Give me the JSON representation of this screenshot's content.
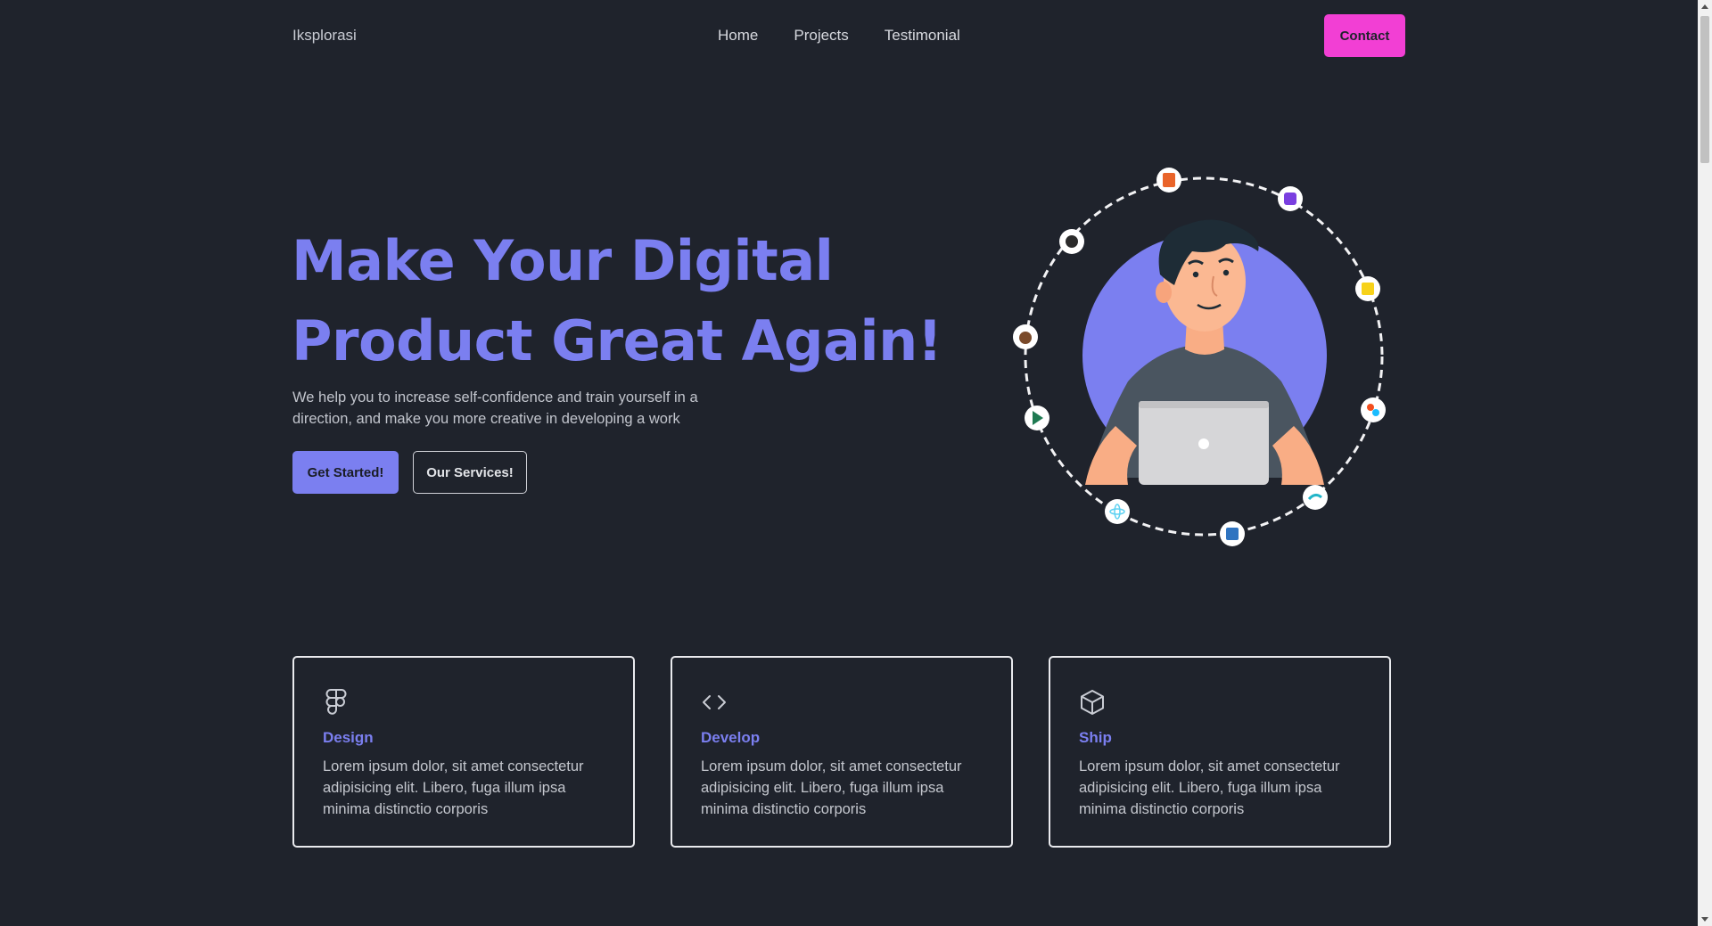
{
  "nav": {
    "brand": "Iksplorasi",
    "links": [
      "Home",
      "Projects",
      "Testimonial"
    ],
    "contact_label": "Contact"
  },
  "hero": {
    "title_line1": "Make Your Digital",
    "title_line2": "Product Great Again!",
    "subtitle": "We help you to increase self-confidence and train yourself in a direction, and make you more creative in developing a work",
    "primary_label": "Get Started!",
    "secondary_label": "Our Services!",
    "illustration": "developer-with-laptop",
    "orbit_icons": [
      "html5-icon",
      "bootstrap-icon",
      "javascript-icon",
      "figma-icon",
      "tailwind-icon",
      "typescript-icon",
      "react-icon",
      "vite-icon",
      "bear-icon",
      "nuxt-icon"
    ]
  },
  "services": [
    {
      "icon": "figma-icon",
      "title": "Design",
      "text": "Lorem ipsum dolor, sit amet consectetur adipisicing elit. Libero, fuga illum ipsa minima distinctio corporis"
    },
    {
      "icon": "code-icon",
      "title": "Develop",
      "text": "Lorem ipsum dolor, sit amet consectetur adipisicing elit. Libero, fuga illum ipsa minima distinctio corporis"
    },
    {
      "icon": "box-icon",
      "title": "Ship",
      "text": "Lorem ipsum dolor, sit amet consectetur adipisicing elit. Libero, fuga illum ipsa minima distinctio corporis"
    }
  ],
  "colors": {
    "background": "#1f232c",
    "accent": "#7b7ff0",
    "contact": "#f23fd4"
  }
}
